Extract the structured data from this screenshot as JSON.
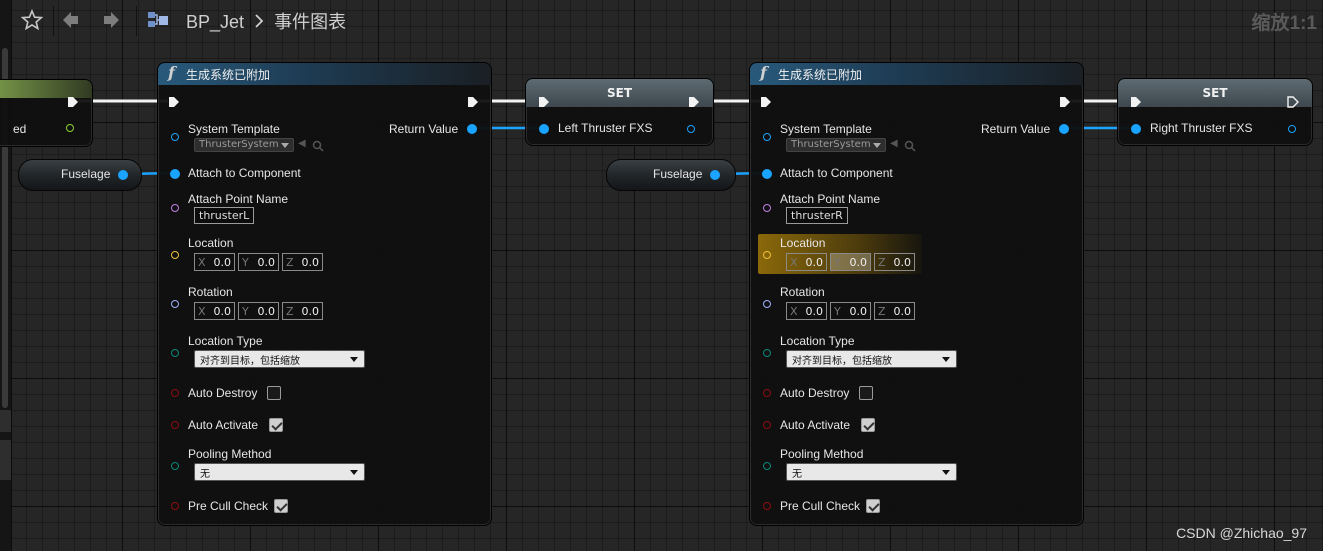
{
  "app": {
    "breadcrumb": [
      "BP_Jet",
      "事件图表"
    ],
    "zoom": "缩放1:1"
  },
  "colors": {
    "background": "#262626",
    "object_pin": "#1aa3ff",
    "string_pin": "#c37ee6",
    "vector_pin": "#f0c03a",
    "rotator_pin": "#9fb1ff",
    "enum_pin": "#0b8a7a",
    "bool_pin": "#8e0f0f",
    "function_header": "#28597b"
  },
  "left_partial_node": {
    "label": "ed"
  },
  "var_left": {
    "label": "Fuselage"
  },
  "var_right": {
    "label": "Fuselage"
  },
  "spawn_left": {
    "title": "生成系统已附加",
    "system_template_label": "System Template",
    "system_template_value": "ThrusterSystem",
    "return_value_label": "Return Value",
    "attach_to_component_label": "Attach to Component",
    "attach_point_label": "Attach Point Name",
    "attach_point_value": "thrusterL",
    "location_label": "Location",
    "location": {
      "x_axis": "X",
      "x": "0.0",
      "y_axis": "Y",
      "y": "0.0",
      "z_axis": "Z",
      "z": "0.0"
    },
    "rotation_label": "Rotation",
    "rotation": {
      "x_axis": "X",
      "x": "0.0",
      "y_axis": "Y",
      "y": "0.0",
      "z_axis": "Z",
      "z": "0.0"
    },
    "location_type_label": "Location Type",
    "location_type_value": "对齐到目标，包括缩放",
    "auto_destroy_label": "Auto Destroy",
    "auto_destroy": false,
    "auto_activate_label": "Auto Activate",
    "auto_activate": true,
    "pooling_method_label": "Pooling Method",
    "pooling_method_value": "无",
    "pre_cull_label": "Pre Cull Check",
    "pre_cull": true
  },
  "set_left": {
    "title": "SET",
    "variable_label": "Left Thruster FXS"
  },
  "spawn_right": {
    "title": "生成系统已附加",
    "system_template_label": "System Template",
    "system_template_value": "ThrusterSystem",
    "return_value_label": "Return Value",
    "attach_to_component_label": "Attach to Component",
    "attach_point_label": "Attach Point Name",
    "attach_point_value": "thrusterR",
    "location_label": "Location",
    "location": {
      "x_axis": "X",
      "x": "0.0",
      "y_axis": "Y",
      "y": "0.0",
      "z_axis": "Z",
      "z": "0.0"
    },
    "rotation_label": "Rotation",
    "rotation": {
      "x_axis": "X",
      "x": "0.0",
      "y_axis": "Y",
      "y": "0.0",
      "z_axis": "Z",
      "z": "0.0"
    },
    "location_type_label": "Location Type",
    "location_type_value": "对齐到目标，包括缩放",
    "auto_destroy_label": "Auto Destroy",
    "auto_destroy": false,
    "auto_activate_label": "Auto Activate",
    "auto_activate": true,
    "pooling_method_label": "Pooling Method",
    "pooling_method_value": "无",
    "pre_cull_label": "Pre Cull Check",
    "pre_cull": true
  },
  "set_right": {
    "title": "SET",
    "variable_label": "Right Thruster FXS"
  },
  "watermark": "CSDN @Zhichao_97"
}
